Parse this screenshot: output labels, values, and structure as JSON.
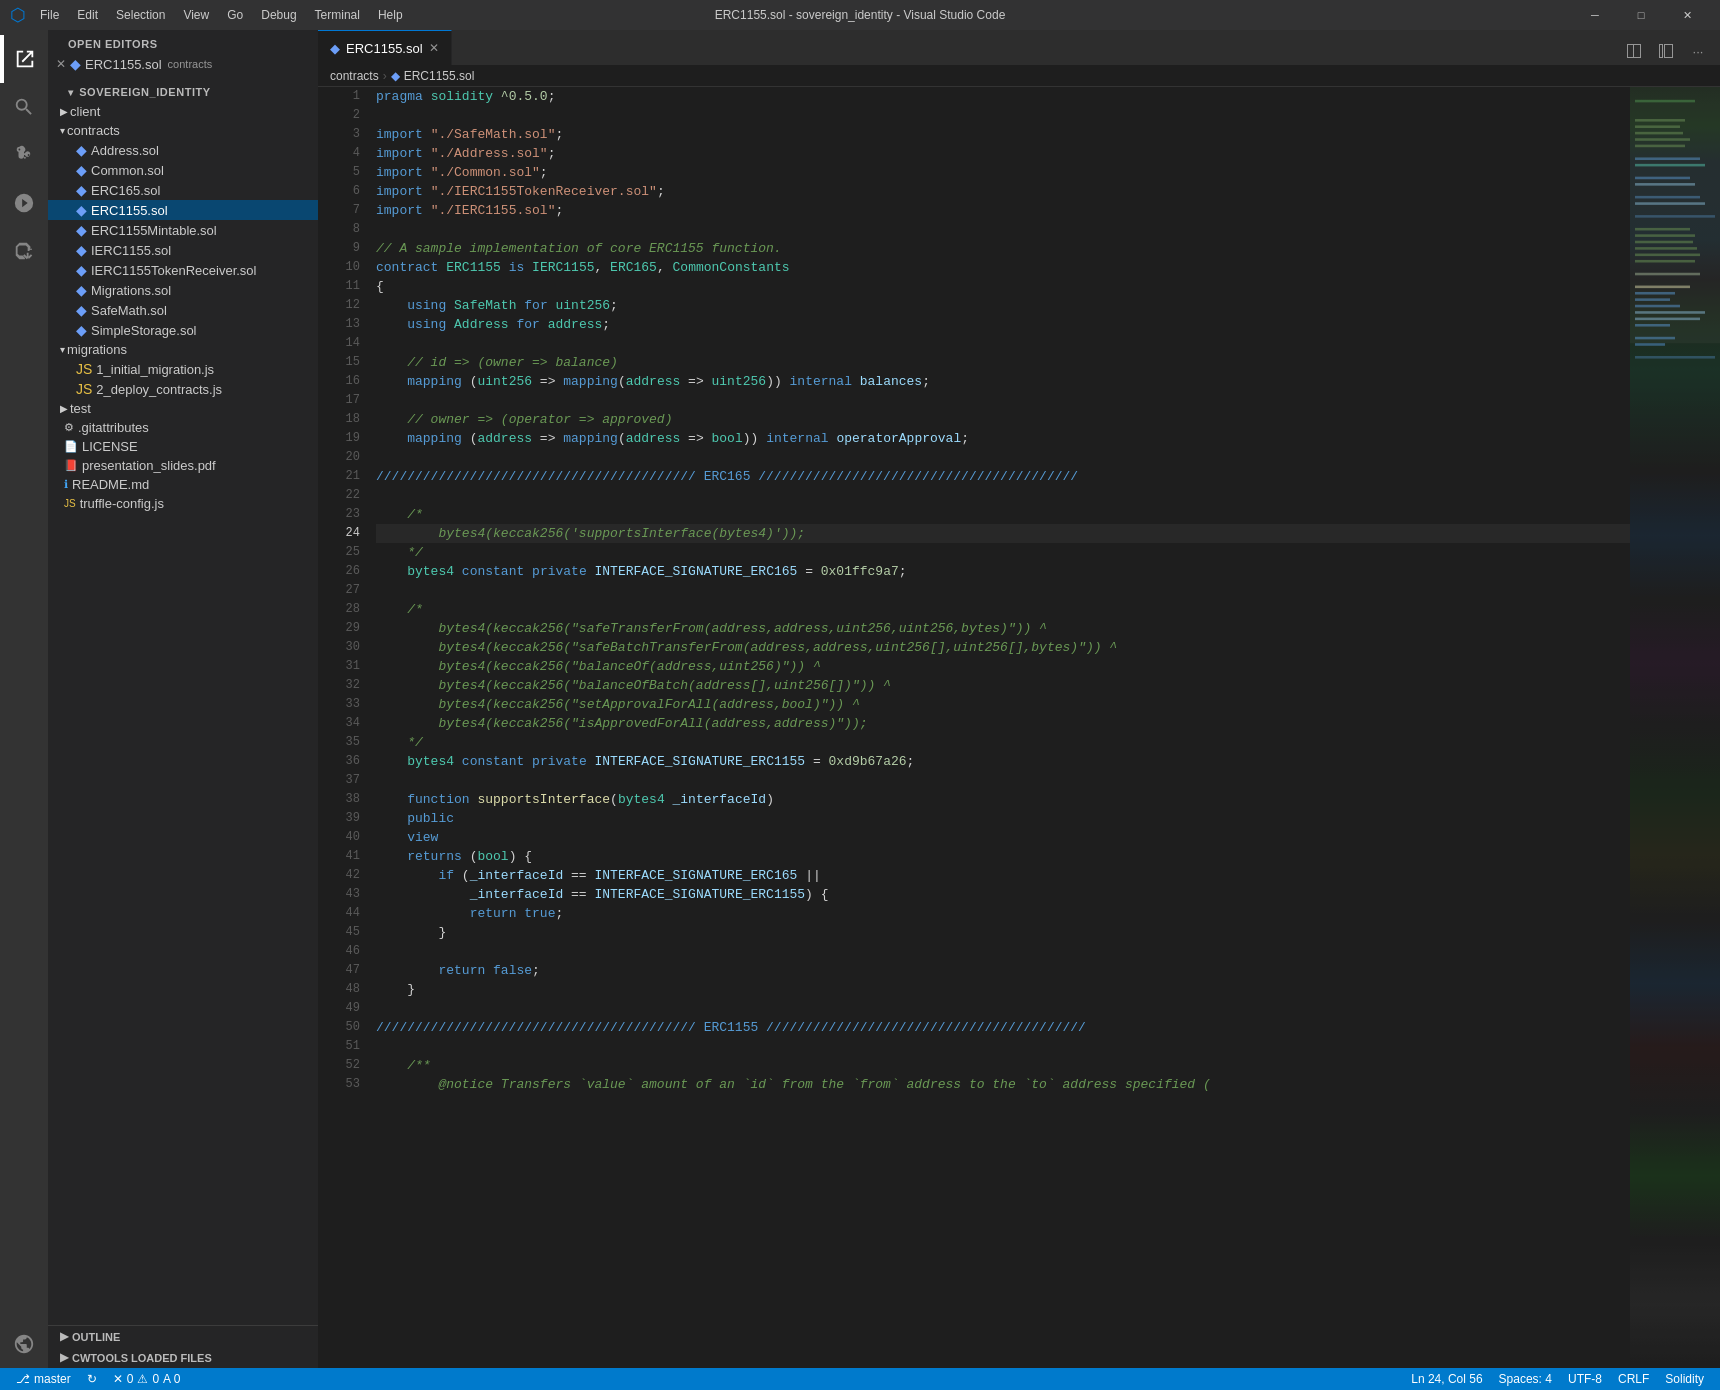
{
  "titlebar": {
    "icon": "⬡",
    "menu": [
      "File",
      "Edit",
      "Selection",
      "View",
      "Go",
      "Debug",
      "Terminal",
      "Help"
    ],
    "title": "ERC1155.sol - sovereign_identity - Visual Studio Code",
    "controls": [
      "─",
      "□",
      "✕"
    ]
  },
  "activity_bar": {
    "icons": [
      {
        "name": "explorer-icon",
        "symbol": "⎘",
        "active": true
      },
      {
        "name": "search-icon",
        "symbol": "🔍"
      },
      {
        "name": "source-control-icon",
        "symbol": "⎇"
      },
      {
        "name": "run-icon",
        "symbol": "▶"
      },
      {
        "name": "extensions-icon",
        "symbol": "⊞"
      },
      {
        "name": "remote-icon",
        "symbol": "❯"
      }
    ]
  },
  "sidebar": {
    "open_editors_title": "OPEN EDITORS",
    "open_editors": [
      {
        "icon": "✕",
        "sol_icon": "◆",
        "name": "ERC1155.sol",
        "extra": "contracts",
        "active": true
      }
    ],
    "project_title": "SOVEREIGN_IDENTITY",
    "tree": [
      {
        "indent": 0,
        "type": "folder",
        "name": "client",
        "open": false
      },
      {
        "indent": 0,
        "type": "folder",
        "name": "contracts",
        "open": true
      },
      {
        "indent": 1,
        "type": "sol",
        "name": "Address.sol"
      },
      {
        "indent": 1,
        "type": "sol",
        "name": "Common.sol"
      },
      {
        "indent": 1,
        "type": "sol",
        "name": "ERC165.sol"
      },
      {
        "indent": 1,
        "type": "sol",
        "name": "ERC1155.sol",
        "active": true
      },
      {
        "indent": 1,
        "type": "sol",
        "name": "ERC1155Mintable.sol"
      },
      {
        "indent": 1,
        "type": "sol",
        "name": "IERC1155.sol"
      },
      {
        "indent": 1,
        "type": "sol",
        "name": "IERC1155TokenReceiver.sol"
      },
      {
        "indent": 1,
        "type": "sol",
        "name": "Migrations.sol"
      },
      {
        "indent": 1,
        "type": "sol",
        "name": "SafeMath.sol"
      },
      {
        "indent": 1,
        "type": "sol",
        "name": "SimpleStorage.sol"
      },
      {
        "indent": 0,
        "type": "folder",
        "name": "migrations",
        "open": true
      },
      {
        "indent": 1,
        "type": "js",
        "name": "1_initial_migration.js"
      },
      {
        "indent": 1,
        "type": "js",
        "name": "2_deploy_contracts.js"
      },
      {
        "indent": 0,
        "type": "folder",
        "name": "test",
        "open": false
      },
      {
        "indent": 0,
        "type": "git",
        "name": ".gitattributes"
      },
      {
        "indent": 0,
        "type": "lic",
        "name": "LICENSE"
      },
      {
        "indent": 0,
        "type": "pdf",
        "name": "presentation_slides.pdf"
      },
      {
        "indent": 0,
        "type": "md",
        "name": "README.md"
      },
      {
        "indent": 0,
        "type": "js",
        "name": "truffle-config.js"
      }
    ]
  },
  "tab": {
    "icon": "◆",
    "name": "ERC1155.sol",
    "active": true
  },
  "breadcrumb": {
    "parts": [
      "contracts",
      ">",
      "◆",
      "ERC1155.sol"
    ]
  },
  "code": {
    "lines": [
      {
        "num": 1,
        "content": "pragma solidity ^0.5.0;"
      },
      {
        "num": 2,
        "content": ""
      },
      {
        "num": 3,
        "content": "import \"./SafeMath.sol\";"
      },
      {
        "num": 4,
        "content": "import \"./Address.sol\";"
      },
      {
        "num": 5,
        "content": "import \"./Common.sol\";"
      },
      {
        "num": 6,
        "content": "import \"./IERC1155TokenReceiver.sol\";"
      },
      {
        "num": 7,
        "content": "import \"./IERC1155.sol\";"
      },
      {
        "num": 8,
        "content": ""
      },
      {
        "num": 9,
        "content": "// A sample implementation of core ERC1155 function."
      },
      {
        "num": 10,
        "content": "contract ERC1155 is IERC1155, ERC165, CommonConstants"
      },
      {
        "num": 11,
        "content": "{"
      },
      {
        "num": 12,
        "content": "    using SafeMath for uint256;"
      },
      {
        "num": 13,
        "content": "    using Address for address;"
      },
      {
        "num": 14,
        "content": ""
      },
      {
        "num": 15,
        "content": "    // id => (owner => balance)"
      },
      {
        "num": 16,
        "content": "    mapping (uint256 => mapping(address => uint256)) internal balances;"
      },
      {
        "num": 17,
        "content": ""
      },
      {
        "num": 18,
        "content": "    // owner => (operator => approved)"
      },
      {
        "num": 19,
        "content": "    mapping (address => mapping(address => bool)) internal operatorApproval;"
      },
      {
        "num": 20,
        "content": ""
      },
      {
        "num": 21,
        "content": "///////////////////////////////////////// ERC165 /////////////////////////////////////////"
      },
      {
        "num": 22,
        "content": ""
      },
      {
        "num": 23,
        "content": "    /*"
      },
      {
        "num": 24,
        "content": "        bytes4(keccak256('supportsInterface(bytes4)'));"
      },
      {
        "num": 25,
        "content": "    */"
      },
      {
        "num": 26,
        "content": "    bytes4 constant private INTERFACE_SIGNATURE_ERC165 = 0x01ffc9a7;"
      },
      {
        "num": 27,
        "content": ""
      },
      {
        "num": 28,
        "content": "    /*"
      },
      {
        "num": 29,
        "content": "        bytes4(keccak256(\"safeTransferFrom(address,address,uint256,uint256,bytes)\")) ^"
      },
      {
        "num": 30,
        "content": "        bytes4(keccak256(\"safeBatchTransferFrom(address,address,uint256[],uint256[],bytes)\")) ^"
      },
      {
        "num": 31,
        "content": "        bytes4(keccak256(\"balanceOf(address,uint256)\")) ^"
      },
      {
        "num": 32,
        "content": "        bytes4(keccak256(\"balanceOfBatch(address[],uint256[])\")) ^"
      },
      {
        "num": 33,
        "content": "        bytes4(keccak256(\"setApprovalForAll(address,bool)\")) ^"
      },
      {
        "num": 34,
        "content": "        bytes4(keccak256(\"isApprovedForAll(address,address)\"));"
      },
      {
        "num": 35,
        "content": "    */"
      },
      {
        "num": 36,
        "content": "    bytes4 constant private INTERFACE_SIGNATURE_ERC1155 = 0xd9b67a26;"
      },
      {
        "num": 37,
        "content": ""
      },
      {
        "num": 38,
        "content": "    function supportsInterface(bytes4 _interfaceId)"
      },
      {
        "num": 39,
        "content": "    public"
      },
      {
        "num": 40,
        "content": "    view"
      },
      {
        "num": 41,
        "content": "    returns (bool) {"
      },
      {
        "num": 42,
        "content": "        if (_interfaceId == INTERFACE_SIGNATURE_ERC165 ||"
      },
      {
        "num": 43,
        "content": "            _interfaceId == INTERFACE_SIGNATURE_ERC1155) {"
      },
      {
        "num": 44,
        "content": "            return true;"
      },
      {
        "num": 45,
        "content": "        }"
      },
      {
        "num": 46,
        "content": ""
      },
      {
        "num": 47,
        "content": "        return false;"
      },
      {
        "num": 48,
        "content": "    }"
      },
      {
        "num": 49,
        "content": ""
      },
      {
        "num": 50,
        "content": "///////////////////////////////////////// ERC1155 /////////////////////////////////////////"
      },
      {
        "num": 51,
        "content": ""
      },
      {
        "num": 52,
        "content": "    /**"
      },
      {
        "num": 53,
        "content": "        @notice Transfers `value` amount of an `id` from the `from` address to the `to` address specified ("
      }
    ]
  },
  "status_bar": {
    "git_icon": "⎇",
    "branch": "master",
    "sync_icon": "↻",
    "error_icon": "✕",
    "errors": "0",
    "warning_icon": "⚠",
    "warnings": "0",
    "info": "A 0",
    "line_col": "Ln 24, Col 56",
    "spaces": "Spaces: 4",
    "encoding": "UTF-8",
    "line_ending": "CRLF",
    "language": "Solidity"
  },
  "colors": {
    "keyword": "#569cd6",
    "keyword2": "#c586c0",
    "string": "#ce9178",
    "number": "#b5cea8",
    "comment": "#6a9955",
    "function": "#dcdcaa",
    "type": "#4ec9b0",
    "variable": "#9cdcfe",
    "plain": "#d4d4d4",
    "active_bg": "#094771",
    "tab_active_border": "#0078d4",
    "status_bar_bg": "#007acc"
  }
}
